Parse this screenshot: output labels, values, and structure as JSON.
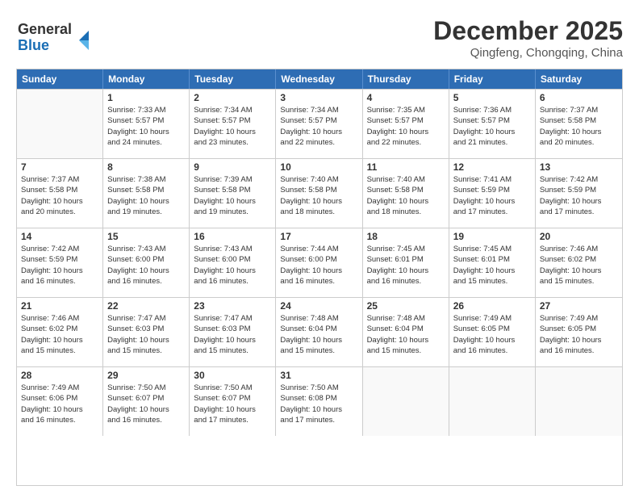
{
  "logo": {
    "line1": "General",
    "line2": "Blue"
  },
  "title": "December 2025",
  "location": "Qingfeng, Chongqing, China",
  "days": [
    "Sunday",
    "Monday",
    "Tuesday",
    "Wednesday",
    "Thursday",
    "Friday",
    "Saturday"
  ],
  "weeks": [
    [
      {
        "day": "",
        "content": ""
      },
      {
        "day": "1",
        "content": "Sunrise: 7:33 AM\nSunset: 5:57 PM\nDaylight: 10 hours\nand 24 minutes."
      },
      {
        "day": "2",
        "content": "Sunrise: 7:34 AM\nSunset: 5:57 PM\nDaylight: 10 hours\nand 23 minutes."
      },
      {
        "day": "3",
        "content": "Sunrise: 7:34 AM\nSunset: 5:57 PM\nDaylight: 10 hours\nand 22 minutes."
      },
      {
        "day": "4",
        "content": "Sunrise: 7:35 AM\nSunset: 5:57 PM\nDaylight: 10 hours\nand 22 minutes."
      },
      {
        "day": "5",
        "content": "Sunrise: 7:36 AM\nSunset: 5:57 PM\nDaylight: 10 hours\nand 21 minutes."
      },
      {
        "day": "6",
        "content": "Sunrise: 7:37 AM\nSunset: 5:58 PM\nDaylight: 10 hours\nand 20 minutes."
      }
    ],
    [
      {
        "day": "7",
        "content": "Sunrise: 7:37 AM\nSunset: 5:58 PM\nDaylight: 10 hours\nand 20 minutes."
      },
      {
        "day": "8",
        "content": "Sunrise: 7:38 AM\nSunset: 5:58 PM\nDaylight: 10 hours\nand 19 minutes."
      },
      {
        "day": "9",
        "content": "Sunrise: 7:39 AM\nSunset: 5:58 PM\nDaylight: 10 hours\nand 19 minutes."
      },
      {
        "day": "10",
        "content": "Sunrise: 7:40 AM\nSunset: 5:58 PM\nDaylight: 10 hours\nand 18 minutes."
      },
      {
        "day": "11",
        "content": "Sunrise: 7:40 AM\nSunset: 5:58 PM\nDaylight: 10 hours\nand 18 minutes."
      },
      {
        "day": "12",
        "content": "Sunrise: 7:41 AM\nSunset: 5:59 PM\nDaylight: 10 hours\nand 17 minutes."
      },
      {
        "day": "13",
        "content": "Sunrise: 7:42 AM\nSunset: 5:59 PM\nDaylight: 10 hours\nand 17 minutes."
      }
    ],
    [
      {
        "day": "14",
        "content": "Sunrise: 7:42 AM\nSunset: 5:59 PM\nDaylight: 10 hours\nand 16 minutes."
      },
      {
        "day": "15",
        "content": "Sunrise: 7:43 AM\nSunset: 6:00 PM\nDaylight: 10 hours\nand 16 minutes."
      },
      {
        "day": "16",
        "content": "Sunrise: 7:43 AM\nSunset: 6:00 PM\nDaylight: 10 hours\nand 16 minutes."
      },
      {
        "day": "17",
        "content": "Sunrise: 7:44 AM\nSunset: 6:00 PM\nDaylight: 10 hours\nand 16 minutes."
      },
      {
        "day": "18",
        "content": "Sunrise: 7:45 AM\nSunset: 6:01 PM\nDaylight: 10 hours\nand 16 minutes."
      },
      {
        "day": "19",
        "content": "Sunrise: 7:45 AM\nSunset: 6:01 PM\nDaylight: 10 hours\nand 15 minutes."
      },
      {
        "day": "20",
        "content": "Sunrise: 7:46 AM\nSunset: 6:02 PM\nDaylight: 10 hours\nand 15 minutes."
      }
    ],
    [
      {
        "day": "21",
        "content": "Sunrise: 7:46 AM\nSunset: 6:02 PM\nDaylight: 10 hours\nand 15 minutes."
      },
      {
        "day": "22",
        "content": "Sunrise: 7:47 AM\nSunset: 6:03 PM\nDaylight: 10 hours\nand 15 minutes."
      },
      {
        "day": "23",
        "content": "Sunrise: 7:47 AM\nSunset: 6:03 PM\nDaylight: 10 hours\nand 15 minutes."
      },
      {
        "day": "24",
        "content": "Sunrise: 7:48 AM\nSunset: 6:04 PM\nDaylight: 10 hours\nand 15 minutes."
      },
      {
        "day": "25",
        "content": "Sunrise: 7:48 AM\nSunset: 6:04 PM\nDaylight: 10 hours\nand 15 minutes."
      },
      {
        "day": "26",
        "content": "Sunrise: 7:49 AM\nSunset: 6:05 PM\nDaylight: 10 hours\nand 16 minutes."
      },
      {
        "day": "27",
        "content": "Sunrise: 7:49 AM\nSunset: 6:05 PM\nDaylight: 10 hours\nand 16 minutes."
      }
    ],
    [
      {
        "day": "28",
        "content": "Sunrise: 7:49 AM\nSunset: 6:06 PM\nDaylight: 10 hours\nand 16 minutes."
      },
      {
        "day": "29",
        "content": "Sunrise: 7:50 AM\nSunset: 6:07 PM\nDaylight: 10 hours\nand 16 minutes."
      },
      {
        "day": "30",
        "content": "Sunrise: 7:50 AM\nSunset: 6:07 PM\nDaylight: 10 hours\nand 17 minutes."
      },
      {
        "day": "31",
        "content": "Sunrise: 7:50 AM\nSunset: 6:08 PM\nDaylight: 10 hours\nand 17 minutes."
      },
      {
        "day": "",
        "content": ""
      },
      {
        "day": "",
        "content": ""
      },
      {
        "day": "",
        "content": ""
      }
    ]
  ]
}
